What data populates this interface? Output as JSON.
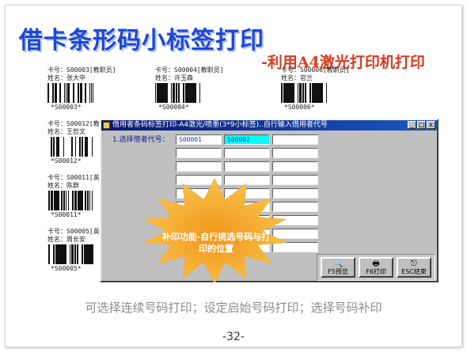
{
  "slide": {
    "title": "借卡条形码小标签打印",
    "subtitle": "-利用A4激光打印机打印",
    "bottom_note": "可选择连续号码打印；设定启始号码打印；选择号码补印",
    "page_number": "-32-"
  },
  "labels": [
    {
      "id": "S00003",
      "card": "卡号：S00003[教职员]",
      "name": "姓名：张大中",
      "code": "*S00003*"
    },
    {
      "id": "S00004",
      "card": "卡号：S00004[教职员]",
      "name": "姓名：许玉森",
      "code": "*S00004*"
    },
    {
      "id": "S00006",
      "card": "卡号：S00006[教职员]",
      "name": "姓名：官兰",
      "code": "*S00006*"
    },
    {
      "id": "S00012",
      "card": "卡号：S00012[教职员]",
      "name": "姓名：王哲文",
      "code": "*S00012*"
    },
    {
      "id": "S00011",
      "card": "卡号：S00011[英一A]",
      "name": "姓名：陈群",
      "code": "*S00011*"
    },
    {
      "id": "S00005",
      "card": "卡号：S00005[英一C]",
      "name": "姓名：周长安",
      "code": "*S00005*"
    }
  ],
  "dialog": {
    "title": "借用者条码标签打印-A4激光/喷墨(3*9小标签)..自行输入借用者代号",
    "window_buttons": {
      "minimize": "_",
      "maximize": "□",
      "close": "x"
    },
    "field_label": "1.选择借者代号：",
    "cells": [
      "S00001",
      "S00002",
      "",
      "",
      "",
      "",
      "",
      "",
      "",
      "",
      "",
      "",
      "",
      "",
      "",
      "",
      "",
      "",
      "",
      "",
      "",
      "",
      "",
      "",
      "",
      "",
      ""
    ],
    "highlight_index": 1,
    "buttons": {
      "preview": "F5预览",
      "print": "F6打印",
      "exit": "ESC结束"
    }
  },
  "callout": {
    "text": "补印功能-自行挑选号码与打印的位置"
  },
  "colors": {
    "title": "#1b48d8",
    "subtitle": "#d83a20",
    "burst": "#f0a020",
    "titlebar": "#08156e",
    "highlight": "#00ffff"
  }
}
